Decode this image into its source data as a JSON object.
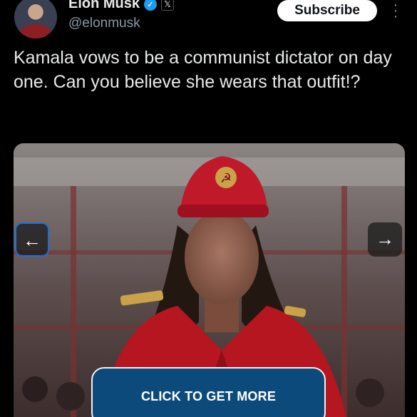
{
  "post": {
    "author_name": "Elon Musk",
    "handle": "@elonmusk",
    "subscribe_label": "Subscribe",
    "more_label": "⋮",
    "verified_glyph": "✓",
    "x_glyph": "𝕏",
    "text": "Kamala vows to be a communist dictator on day one. Can you believe she wears that outfit!?"
  },
  "media": {
    "description_icon": "image",
    "prev_label": "←",
    "next_label": "→",
    "cta_label": "CLICK TO GET MORE"
  },
  "colors": {
    "background": "#000000",
    "verified": "#1d9bf0",
    "cta_background": "#0d4a7c",
    "uniform_red": "#b5161f"
  }
}
